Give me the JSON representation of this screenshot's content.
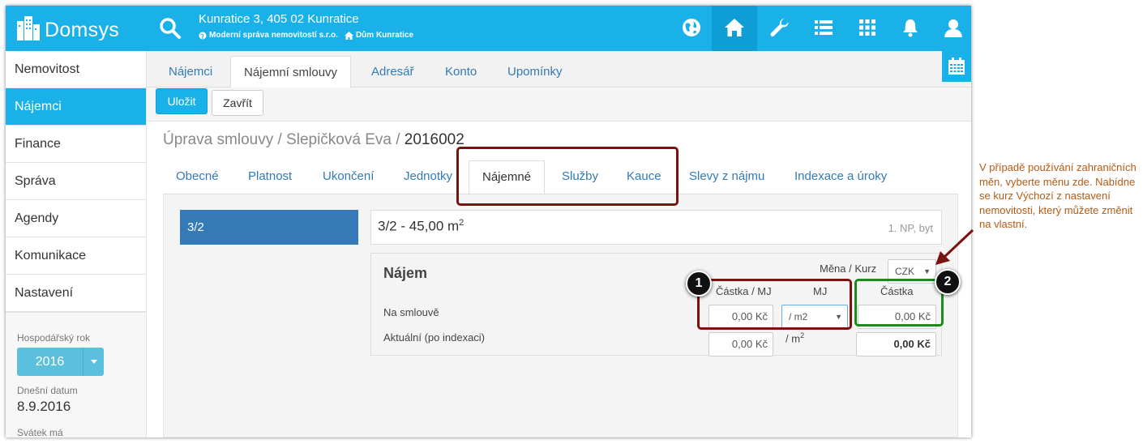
{
  "app": {
    "logo": "Domsys"
  },
  "header": {
    "address": "Kunratice 3, 405 02 Kunratice",
    "company": "Moderní správa nemovitostí s.r.o.",
    "building": "Dům Kunratice",
    "icons": [
      "globe-icon",
      "home-icon",
      "wrench-icon",
      "list-icon",
      "grid-icon",
      "bell-icon",
      "user-icon"
    ],
    "accent": "#1ab0e8"
  },
  "sidebar": {
    "items": [
      {
        "label": "Nemovitost"
      },
      {
        "label": "Nájemci",
        "active": true
      },
      {
        "label": "Finance"
      },
      {
        "label": "Správa"
      },
      {
        "label": "Agendy"
      },
      {
        "label": "Komunikace"
      },
      {
        "label": "Nastavení"
      }
    ],
    "fiscal_year_label": "Hospodářský rok",
    "fiscal_year": "2016",
    "today_label": "Dnešní datum",
    "today": "8.9.2016",
    "nameday_label": "Svátek má"
  },
  "main_tabs": [
    "Nájemci",
    "Nájemní smlouvy",
    "Adresář",
    "Konto",
    "Upomínky"
  ],
  "toolbar": {
    "save": "Uložit",
    "close": "Zavřít"
  },
  "breadcrumb": {
    "path": "Úprava smlouvy / Slepičková Eva / ",
    "current": "2016002"
  },
  "sub_tabs": [
    "Obecné",
    "Platnost",
    "Ukončení",
    "Jednotky",
    "Nájemné",
    "Služby",
    "Kauce",
    "Slevy z nájmu",
    "Indexace a úroky"
  ],
  "unit": {
    "button": "3/2",
    "name": "3/2 - 45,00 m",
    "name_sup": "2",
    "info": "1. NP, byt"
  },
  "rent": {
    "title": "Nájem",
    "currency_label": "Měna / Kurz",
    "currency": "CZK",
    "col_amount_per_unit": "Částka / MJ",
    "col_unit": "MJ",
    "col_amount": "Částka",
    "row_contract": "Na smlouvě",
    "row_actual": "Aktuální (po indexaci)",
    "contract_amount_per_unit": "0,00 Kč",
    "contract_unit": "/ m2",
    "contract_amount": "0,00 Kč",
    "actual_amount_per_unit": "0,00 Kč",
    "actual_unit": "/ m",
    "actual_unit_sup": "2",
    "actual_amount": "0,00 Kč"
  },
  "annotation": {
    "marker1": "1",
    "marker2": "2",
    "note": "V případě používání zahraničních měn, vyberte měnu zde. Nabídne se kurz Výchozí z nastavení nemovitosti, který můžete změnit na vlastní."
  }
}
